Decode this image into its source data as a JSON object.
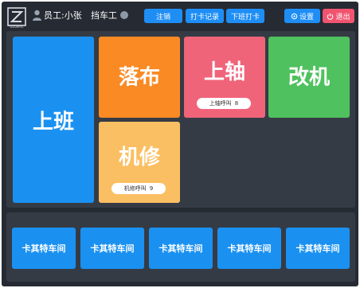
{
  "header": {
    "logo_text": "GLOBAL",
    "user_name": "员工:小张",
    "role": "挡车工",
    "buttons": {
      "cancel": "注销",
      "punch_record": "打卡记录",
      "off_duty": "下班打卡",
      "settings": "设置",
      "logout": "退出"
    }
  },
  "tiles": {
    "on_duty": "上班",
    "fabric_down": "落布",
    "beam_up": {
      "label": "上轴",
      "call_label": "上轴呼叫",
      "call_count": "8"
    },
    "change_machine": "改机",
    "repair": {
      "label": "机修",
      "call_label": "机修呼叫",
      "call_count": "9"
    }
  },
  "workshops": [
    "卡其特车间",
    "卡其特车间",
    "卡其特车间",
    "卡其特车间",
    "卡其特车间"
  ],
  "colors": {
    "background": "#262b33",
    "panel": "#353b45",
    "blue": "#1a91f1",
    "orange": "#f98a24",
    "pink": "#f0647a",
    "green": "#4fc15e",
    "yellow": "#fbbf63",
    "logout": "#f0546f"
  }
}
